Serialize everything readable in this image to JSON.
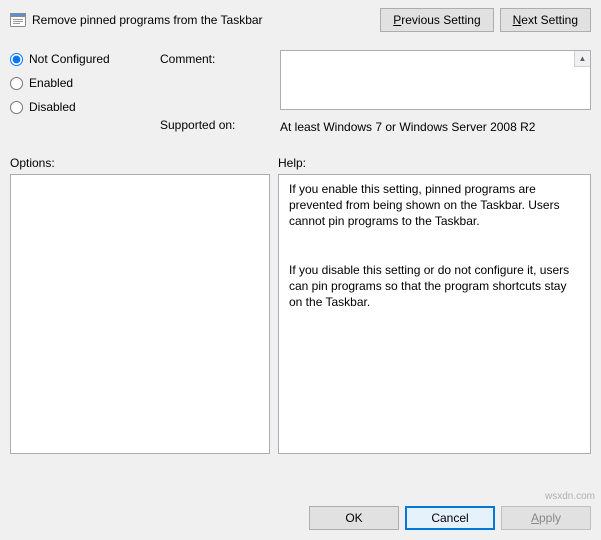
{
  "title": "Remove pinned programs from the Taskbar",
  "nav": {
    "previous": "Previous Setting",
    "previous_uchar": "P",
    "next": "Next Setting",
    "next_uchar": "N"
  },
  "state": {
    "not_configured": "Not Configured",
    "not_configured_uchar": "C",
    "enabled": "Enabled",
    "enabled_uchar": "E",
    "disabled": "Disabled",
    "disabled_uchar": "D",
    "selected": "not_configured"
  },
  "labels": {
    "comment": "Comment:",
    "supported_on": "Supported on:",
    "options": "Options:",
    "help": "Help:"
  },
  "comment_value": "",
  "supported_on_value": "At least Windows 7 or Windows Server 2008 R2",
  "help_text": "If you enable this setting, pinned programs are prevented from being shown on the Taskbar. Users cannot pin programs to the Taskbar.\n\n\nIf you disable this setting or do not configure it, users can pin programs so that the program shortcuts stay on the Taskbar.",
  "buttons": {
    "ok": "OK",
    "cancel": "Cancel",
    "apply": "Apply",
    "apply_uchar": "A"
  },
  "watermark": "wsxdn.com"
}
